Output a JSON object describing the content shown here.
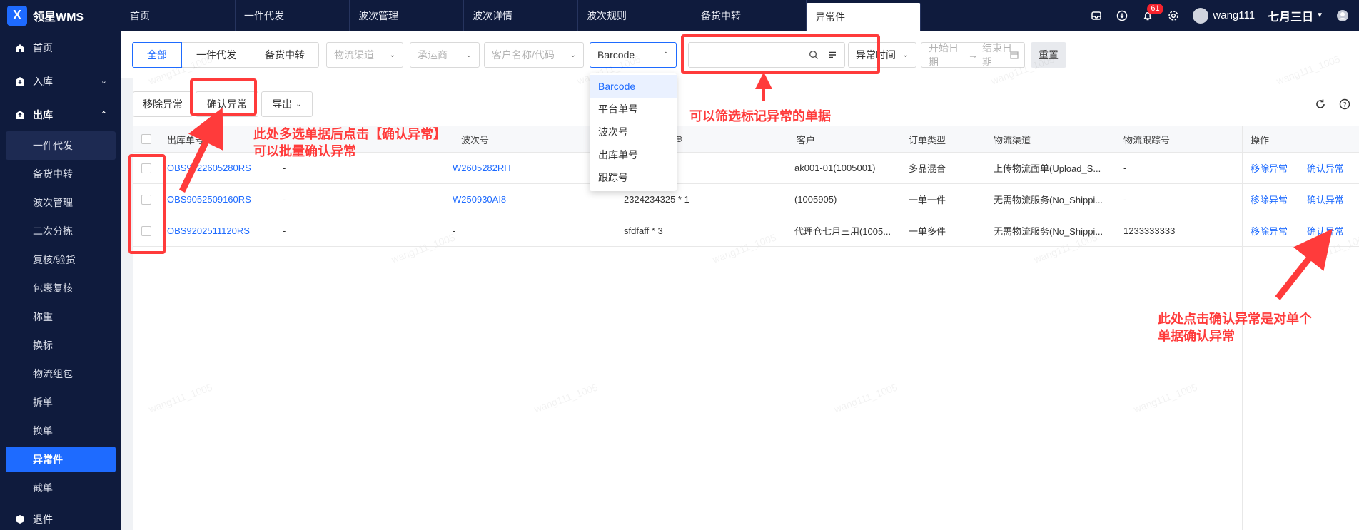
{
  "app": {
    "logo_text": "领星WMS",
    "logo_mark": "X"
  },
  "tabs": [
    "首页",
    "一件代发",
    "波次管理",
    "波次详情",
    "波次规则",
    "备货中转",
    "异常件"
  ],
  "topbar": {
    "notification_count": "61",
    "username": "wang111",
    "date": "七月三日"
  },
  "sidebar": {
    "home": "首页",
    "inbound": "入库",
    "outbound": "出库",
    "sub_items": [
      "一件代发",
      "备货中转",
      "波次管理",
      "二次分拣",
      "复核/验货",
      "包裹复核",
      "称重",
      "换标",
      "物流组包",
      "拆单",
      "换单",
      "异常件",
      "截单"
    ],
    "returns": "退件"
  },
  "filters": {
    "segments": [
      "全部",
      "一件代发",
      "备货中转"
    ],
    "channel_ph": "物流渠道",
    "carrier_ph": "承运商",
    "customer_ph": "客户名称/代码",
    "field_select": "Barcode",
    "search_value": "",
    "time_select": "异常时间",
    "start_date": "开始日期",
    "end_date": "结束日期",
    "reset": "重置"
  },
  "dropdown_options": [
    "Barcode",
    "平台单号",
    "波次号",
    "出库单号",
    "跟踪号"
  ],
  "actions": {
    "remove": "移除异常",
    "confirm": "确认异常",
    "export": "导出"
  },
  "table": {
    "headers": {
      "order_no": "出库单号",
      "wave_no": "波次号",
      "product": "⊕",
      "customer": "客户",
      "order_type": "订单类型",
      "channel": "物流渠道",
      "tracking": "物流跟踪号",
      "ops": "操作"
    },
    "rows": [
      {
        "order_no": "OBS9022605280RS",
        "col2": "-",
        "wave": "W2605282RH",
        "product": "",
        "customer": "ak001-01(1005001)",
        "type": "多品混合",
        "channel": "上传物流面单(Upload_S...",
        "tracking": "-",
        "op1": "移除异常",
        "op2": "确认异常"
      },
      {
        "order_no": "OBS9052509160RS",
        "col2": "-",
        "wave": "W250930AI8",
        "product": "2324234325 * 1",
        "customer": "(1005905)",
        "type": "一单一件",
        "channel": "无需物流服务(No_Shippi...",
        "tracking": "-",
        "op1": "移除异常",
        "op2": "确认异常"
      },
      {
        "order_no": "OBS9202511120RS",
        "col2": "-",
        "wave": "-",
        "product": "sfdfaff * 3",
        "customer": "代理仓七月三用(1005...",
        "type": "一单多件",
        "channel": "无需物流服务(No_Shippi...",
        "tracking": "1233333333",
        "op1": "移除异常",
        "op2": "确认异常"
      }
    ]
  },
  "annotations": {
    "a1_line1": "此处多选单据后点击【确认异常】",
    "a1_line2": "可以批量确认异常",
    "a2": "可以筛选标记异常的单据",
    "a3_line1": "此处点击确认异常是对单个",
    "a3_line2": "单据确认异常"
  },
  "watermark": "wang111_1005",
  "colors": {
    "nav_bg": "#0f1b3d",
    "accent": "#1e6bff",
    "annotation": "#ff3b3b"
  }
}
